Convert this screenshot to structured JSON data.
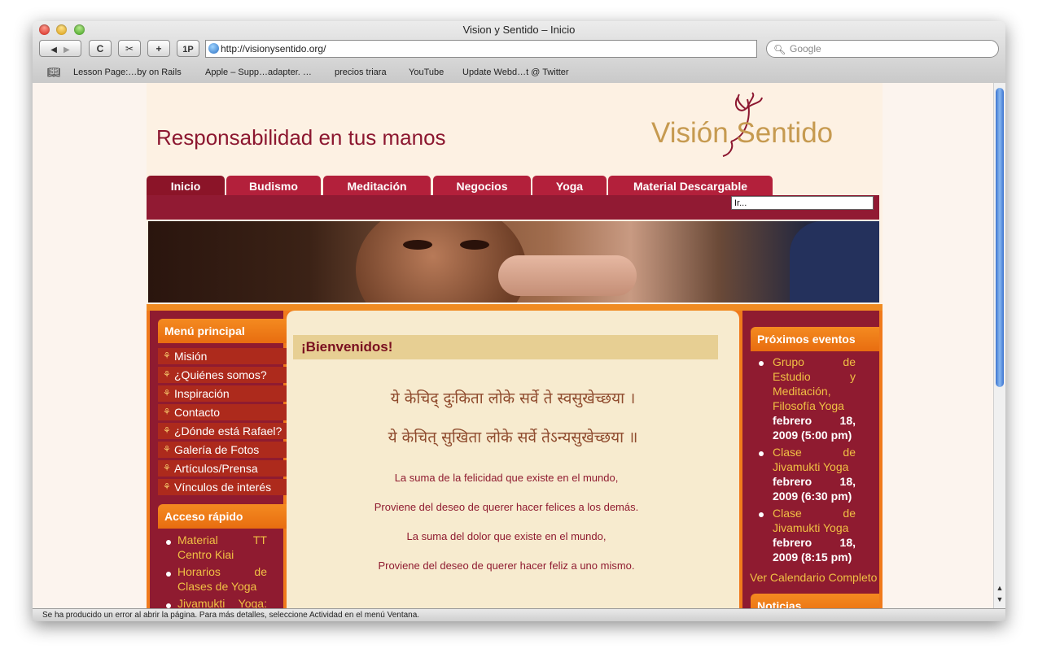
{
  "window": {
    "title": "Vision y Sentido – Inicio",
    "url": "http://visionysentido.org/",
    "search_placeholder": "Google",
    "status": "Se ha producido un error al abrir la página. Para más detalles, seleccione Actividad en el menú Ventana."
  },
  "toolbar": {
    "back": "◀",
    "forward": "▶",
    "reload": "C",
    "add": "+",
    "onepassword": "1P"
  },
  "bookmarks": [
    "Lesson Page:…by on Rails",
    "Apple – Supp…adapter. …",
    "precios triara",
    "YouTube",
    "Update Webd…t @ Twitter"
  ],
  "site": {
    "slogan": "Responsabilidad en tus manos",
    "logo_text": "Visión Sentido",
    "nav": [
      "Inicio",
      "Budismo",
      "Meditación",
      "Negocios",
      "Yoga",
      "Material Descargable"
    ],
    "search_value": "Ir..."
  },
  "left": {
    "menu_title": "Menú principal",
    "menu": [
      "Misión",
      "¿Quiénes somos?",
      "Inspiración",
      "Contacto",
      "¿Dónde está Rafael?",
      "Galería de Fotos",
      "Artículos/Prensa",
      "Vínculos de interés"
    ],
    "quick_title": "Acceso rápido",
    "quick": [
      "Material TT",
      "Centro Kiai",
      "Horarios de",
      "Clases de Yoga",
      "Jivamukti Yoga:"
    ]
  },
  "main": {
    "welcome": "¡Bienvenidos!",
    "sanskrit_1": "ये केचिद्‌ दुःकिता लोके सर्वे ते स्वसुखेच्छया ।",
    "sanskrit_2": "ये केचित्‌ सुखिता लोके सर्वे तेऽन्यसुखेच्छया ॥",
    "verse_1": "La suma de la felicidad que existe en el mundo,",
    "verse_2": "Proviene del deseo de querer hacer felices a los demás.",
    "verse_3": "La suma del dolor que existe en el mundo,",
    "verse_4": "Proviene del deseo de querer hacer feliz a uno mismo."
  },
  "right": {
    "events_title": "Próximos eventos",
    "event1_lines": [
      "Grupo de",
      "Estudio y",
      "Meditación,",
      "Filosofía Yoga"
    ],
    "event1_date": [
      "febrero 18,",
      "2009 (5:00 pm)"
    ],
    "event2_lines": [
      "Clase de",
      "Jivamukti Yoga"
    ],
    "event2_date": [
      "febrero 18,",
      "2009 (6:30 pm)"
    ],
    "event3_lines": [
      "Clase de",
      "Jivamukti Yoga"
    ],
    "event3_date": [
      "febrero 18,",
      "2009 (8:15 pm)"
    ],
    "calendar_link": "Ver Calendario Completo",
    "news_title": "Noticias"
  }
}
